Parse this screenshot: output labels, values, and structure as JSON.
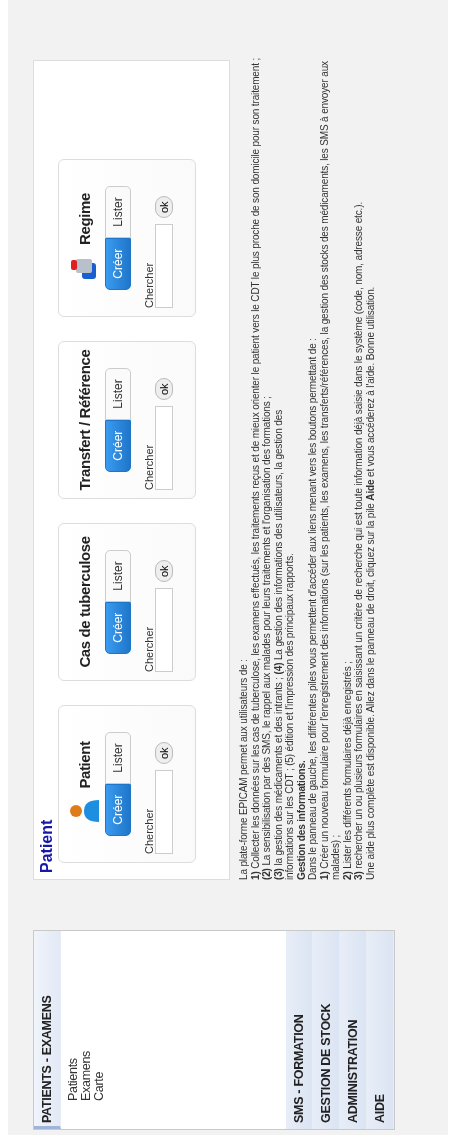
{
  "sidebar": {
    "sections": [
      {
        "title": "PATIENTS - EXAMENS",
        "expanded": true,
        "items": [
          "Patients",
          "Examens",
          "Carte"
        ]
      },
      {
        "title": "SMS - FORMATION",
        "expanded": false
      },
      {
        "title": "GESTION DE STOCK",
        "expanded": false
      },
      {
        "title": "ADMINISTRATION",
        "expanded": false
      },
      {
        "title": "AIDE",
        "expanded": false
      }
    ]
  },
  "panel": {
    "title": "Patient",
    "cards": [
      {
        "title": "Patient",
        "kind": "person",
        "create": "Créer",
        "list": "Lister",
        "search_label": "Chercher",
        "ok": "ok"
      },
      {
        "title": "Cas de tuberculose",
        "create": "Créer",
        "list": "Lister",
        "search_label": "Chercher",
        "ok": "ok"
      },
      {
        "title": "Transfert / Référence",
        "create": "Créer",
        "list": "Lister",
        "search_label": "Chercher",
        "ok": "ok"
      },
      {
        "title": "Regime",
        "kind": "bottle",
        "create": "Créer",
        "list": "Lister",
        "search_label": "Chercher",
        "ok": "ok"
      }
    ]
  },
  "intro": [
    {
      "text": "La plate-forme EPICAM permet aux utilisateurs de :"
    },
    {
      "text": "**1)** Collecter les données sur les cas de tuberculose, les examens effectués, les traitements reçus et de mieux orienter le patient vers le CDT le plus proche de son domicile pour son traitement ;"
    },
    {
      "text": "**(2)** La sensibilisation par des SMS, le rappel aux malades pour leurs traitements et l'organisation des formations ;"
    },
    {
      "text": "**(3)** la gestion des médicaments et des intrants ; **(4)** La gestion des informations des utilisateurs, la gestion des"
    },
    {
      "text": "informations sur les CDT ; (5) édition et l'impression des principaux rapports."
    },
    {
      "text": "Gestion des informations.",
      "kind": "heading"
    },
    {
      "text": "Dans le panneau de gauche, les différentes piles vous permettent d'accéder aux liens menant vers les boutons permettant de :"
    },
    {
      "text": "**1)** Créer un nouveau formulaire pour l'enregistrement des informations (sur les patients, les examens, les transferts/références, la gestion des stocks des médicaments, les SMS à envoyer aux malades) ;"
    },
    {
      "text": "**2)** Lister les différents formulaires déjà enregistrés ;"
    },
    {
      "text": "**3)** rechercher un ou plusieurs formulaires en saisissant un critère de recherche qui est toute information déjà saisie dans le système (code, nom, adresse etc.)."
    },
    {
      "text": "Une aide plus complète est disponible. Allez dans le panneau de droit, cliquez sur la pile **Aide** et vous accéderez à l'aide. Bonne utilisation."
    }
  ]
}
